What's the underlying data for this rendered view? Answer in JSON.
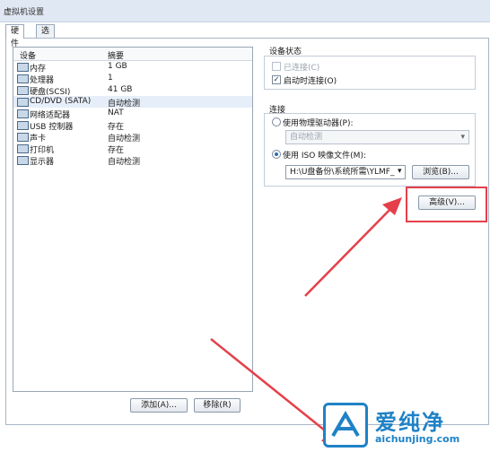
{
  "window": {
    "title": "虚拟机设置"
  },
  "tabs": [
    {
      "label": "硬件"
    },
    {
      "label": "选项"
    }
  ],
  "device_list": {
    "headers": {
      "device": "设备",
      "summary": "摘要"
    },
    "rows": [
      {
        "name": "内存",
        "summary": "1 GB",
        "icon": "memory-icon"
      },
      {
        "name": "处理器",
        "summary": "1",
        "icon": "cpu-icon"
      },
      {
        "name": "硬盘(SCSI)",
        "summary": "41 GB",
        "icon": "harddisk-icon"
      },
      {
        "name": "CD/DVD (SATA)",
        "summary": "自动检测",
        "icon": "cdrom-icon"
      },
      {
        "name": "网络适配器",
        "summary": "NAT",
        "icon": "network-icon"
      },
      {
        "name": "USB 控制器",
        "summary": "存在",
        "icon": "usb-icon"
      },
      {
        "name": "声卡",
        "summary": "自动检测",
        "icon": "sound-icon"
      },
      {
        "name": "打印机",
        "summary": "存在",
        "icon": "printer-icon"
      },
      {
        "name": "显示器",
        "summary": "自动检测",
        "icon": "display-icon"
      }
    ],
    "add_button": "添加(A)...",
    "remove_button": "移除(R)"
  },
  "device_status": {
    "title": "设备状态",
    "connected": "已连接(C)",
    "connect_on_power": "启动时连接(O)"
  },
  "connection": {
    "title": "连接",
    "physical_drive": "使用物理驱动器(P):",
    "physical_drive_value": "自动检测",
    "iso_image": "使用 ISO 映像文件(M):",
    "iso_path": "H:\\U盘备份\\系统所需\\YLMF_",
    "browse_button": "浏览(B)...",
    "advanced_button": "高级(V)..."
  },
  "watermark": {
    "brand": "爱纯净",
    "url": "aichunjing.com"
  },
  "colors": {
    "accent_red": "#e5404a",
    "brand_blue": "#1f82c6"
  }
}
